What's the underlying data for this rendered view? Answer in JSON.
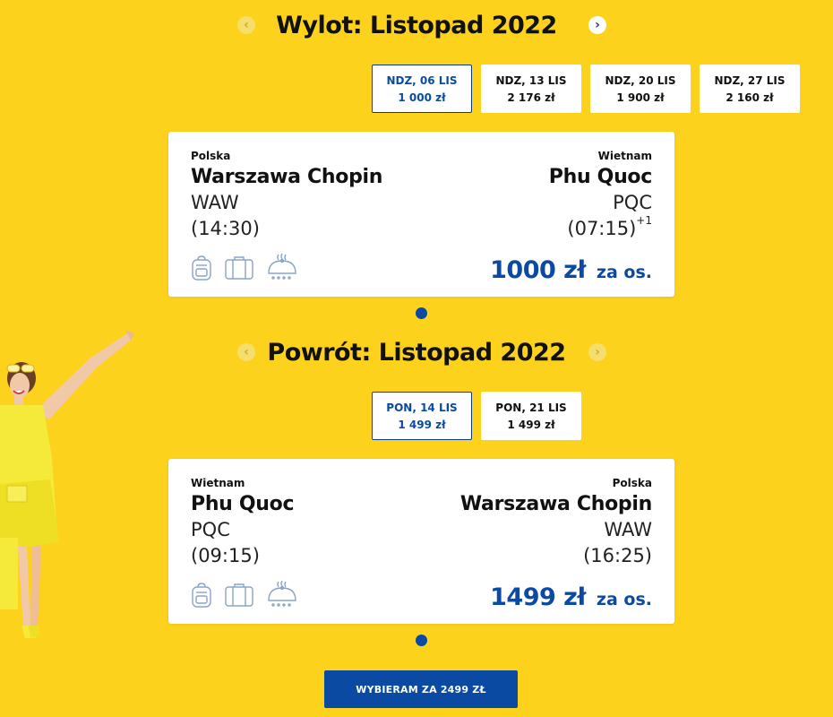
{
  "outbound": {
    "title": "Wylot: Listopad 2022",
    "dates": [
      {
        "day": "NDZ, 06 LIS",
        "price": "1 000 zł",
        "active": true
      },
      {
        "day": "NDZ, 13 LIS",
        "price": "2 176 zł",
        "active": false
      },
      {
        "day": "NDZ, 20 LIS",
        "price": "1 900 zł",
        "active": false
      },
      {
        "day": "NDZ, 27 LIS",
        "price": "2 160 zł",
        "active": false
      }
    ],
    "flight": {
      "from_country": "Polska",
      "from_city": "Warszawa Chopin",
      "from_code": "WAW",
      "depart_time": "(14:30)",
      "to_country": "Wietnam",
      "to_city": "Phu Quoc",
      "to_code": "PQC",
      "arrive_time": "(07:15)",
      "arrive_day_offset": "+1",
      "price": "1000 zł",
      "per_person": "za os."
    }
  },
  "return": {
    "title": "Powrót: Listopad 2022",
    "dates": [
      {
        "day": "PON, 14 LIS",
        "price": "1 499 zł",
        "active": true
      },
      {
        "day": "PON, 21 LIS",
        "price": "1 499 zł",
        "active": false
      }
    ],
    "flight": {
      "from_country": "Wietnam",
      "from_city": "Phu Quoc",
      "from_code": "PQC",
      "depart_time": "(09:15)",
      "to_country": "Polska",
      "to_city": "Warszawa Chopin",
      "to_code": "WAW",
      "arrive_time": "(16:25)",
      "price": "1499 zł",
      "per_person": "za os."
    }
  },
  "cta": {
    "label": "WYBIERAM ZA 2499 ZŁ"
  },
  "icons": {
    "prev": "chevron-left-icon",
    "next": "chevron-right-icon",
    "amenities": [
      "backpack-icon",
      "suitcase-icon",
      "meal-icon"
    ]
  },
  "colors": {
    "background": "#fcd21c",
    "accent": "#0a4aa3"
  }
}
